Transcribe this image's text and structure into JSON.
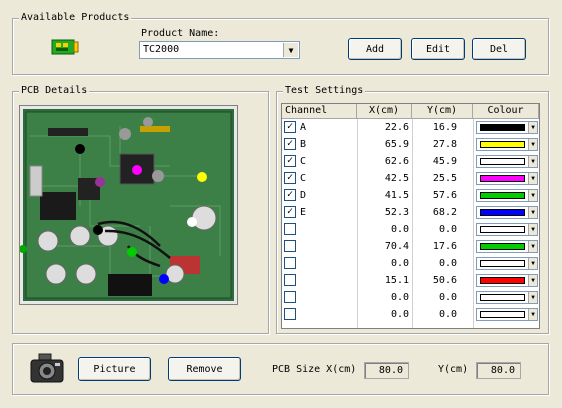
{
  "available_products": {
    "title": "Available Products",
    "product_name_label": "Product Name:",
    "product_name_value": "TC2000",
    "add_label": "Add",
    "edit_label": "Edit",
    "del_label": "Del"
  },
  "pcb_details": {
    "title": "PCB Details"
  },
  "test_settings": {
    "title": "Test Settings",
    "headers": [
      "Channel",
      "X(cm)",
      "Y(cm)",
      "Colour"
    ],
    "rows": [
      {
        "checked": true,
        "channel": "A",
        "x": "22.6",
        "y": "16.9",
        "colour": "#000000"
      },
      {
        "checked": true,
        "channel": "B",
        "x": "65.9",
        "y": "27.8",
        "colour": "#ffff00"
      },
      {
        "checked": true,
        "channel": "C",
        "x": "62.6",
        "y": "45.9",
        "colour": "#ffffff"
      },
      {
        "checked": true,
        "channel": "C",
        "x": "42.5",
        "y": "25.5",
        "colour": "#ff00ff"
      },
      {
        "checked": true,
        "channel": "D",
        "x": "41.5",
        "y": "57.6",
        "colour": "#00cc00"
      },
      {
        "checked": true,
        "channel": "E",
        "x": "52.3",
        "y": "68.2",
        "colour": "#0000ff"
      },
      {
        "checked": false,
        "channel": "",
        "x": "0.0",
        "y": "0.0",
        "colour": "#ffffff"
      },
      {
        "checked": false,
        "channel": "",
        "x": "70.4",
        "y": "17.6",
        "colour": "#00cc00"
      },
      {
        "checked": false,
        "channel": "",
        "x": "0.0",
        "y": "0.0",
        "colour": "#ffffff"
      },
      {
        "checked": false,
        "channel": "",
        "x": "15.1",
        "y": "50.6",
        "colour": "#ff0000"
      },
      {
        "checked": false,
        "channel": "",
        "x": "0.0",
        "y": "0.0",
        "colour": "#ffffff"
      },
      {
        "checked": false,
        "channel": "",
        "x": "0.0",
        "y": "0.0",
        "colour": "#ffffff"
      }
    ]
  },
  "bottom": {
    "picture_label": "Picture",
    "remove_label": "Remove",
    "pcb_size_x_label": "PCB Size X(cm)",
    "pcb_size_x_value": "80.0",
    "y_label": "Y(cm)",
    "y_value": "80.0"
  },
  "icons": {
    "product": "circuit-board-icon",
    "camera": "camera-icon"
  }
}
